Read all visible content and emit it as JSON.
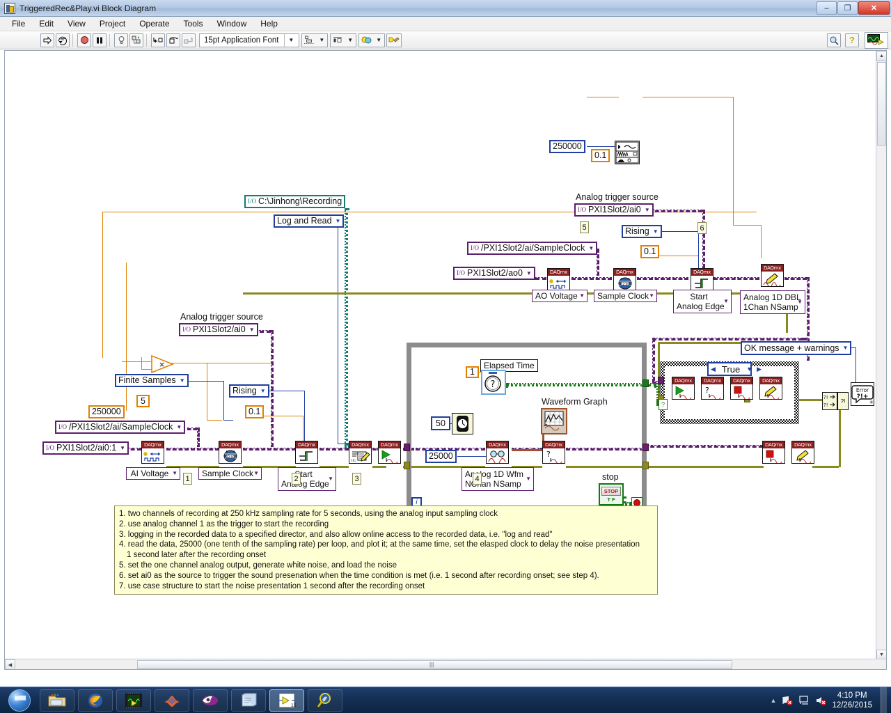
{
  "window": {
    "title": "TriggeredRec&Play.vi Block Diagram",
    "minimize": "–",
    "maximize": "❐",
    "close": "✕"
  },
  "menu": [
    "File",
    "Edit",
    "View",
    "Project",
    "Operate",
    "Tools",
    "Window",
    "Help"
  ],
  "toolbar": {
    "run_label": "run-arrow",
    "run_continuous_label": "run-continuously",
    "abort_label": "abort-execution",
    "pause_label": "pause",
    "highlight_label": "highlight-execution",
    "step_into_label": "step-into",
    "step_over_label": "step-over",
    "step_out_label": "step-out",
    "font": "15pt Application Font",
    "align_label": "align-objects",
    "distribute_label": "distribute-objects",
    "reorder_label": "reorder",
    "cleanup_label": "clean-up-diagram",
    "search_label": "search",
    "help_label": "?"
  },
  "diagram": {
    "constants": {
      "rate_ao": "250000",
      "amp_ao": "0.1",
      "rate_ai": "250000",
      "seconds": "5",
      "trig_level_ai": "0.1",
      "trig_level_ao": "0.1",
      "elapsed_target": "1",
      "wait_ms": "50",
      "samples_per_read": "25000"
    },
    "controls": {
      "log_path": "C:\\Jinhong\\Recording",
      "logging_mode": "Log and Read",
      "sample_mode": "Finite Samples",
      "ai_trigger_slope": "Rising",
      "ao_trigger_slope": "Rising",
      "ai_sample_clock_src": "/PXI1Slot2/ai/SampleClock",
      "ao_sample_clock_src": "/PXI1Slot2/ai/SampleClock",
      "ai_physical_channel": "PXI1Slot2/ai0:1",
      "ao_physical_channel": "PXI1Slot2/ao0",
      "analog_trigger_source_ai": "PXI1Slot2/ai0",
      "analog_trigger_source_ao": "PXI1Slot2/ai0",
      "error_dialog_type": "OK message + warnings",
      "case_selector": "True"
    },
    "labels": {
      "analog_trigger_source_ai": "Analog trigger source",
      "analog_trigger_source_ao": "Analog trigger source",
      "elapsed_time": "Elapsed Time",
      "waveform_graph": "Waveform Graph",
      "stop": "stop",
      "loop_index": "i"
    },
    "vi_labels": {
      "ai_voltage": "AI Voltage",
      "ai_sample_clock": "Sample Clock",
      "ai_start_trigger": "Start\nAnalog Edge",
      "ao_voltage": "AO Voltage",
      "ao_sample_clock": "Sample Clock",
      "ao_start_trigger": "Start\nAnalog Edge",
      "ao_write_type": "Analog 1D DBL\n1Chan NSamp",
      "ai_read_type": "Analog 1D Wfm\nNChan NSamp"
    },
    "daq_header": "DAQmx",
    "step_markers": [
      "1",
      "2",
      "3",
      "4",
      "5",
      "6"
    ],
    "stop_button_text": "STOP",
    "stop_button_tf": "T F",
    "error_icon_text": "Error",
    "error_icon_sub": "?!+"
  },
  "comment": {
    "lines": [
      {
        "text": "1. two channels of recording at 250 kHz sampling rate for 5 seconds, using the analog input sampling clock",
        "indent": false
      },
      {
        "text": "2. use analog channel 1 as the trigger to start the recording",
        "indent": false
      },
      {
        "text": "3. logging in the recorded data to a specified director, and also allow online access to the recorded data, i.e. \"log and read\"",
        "indent": false
      },
      {
        "text": "4. read the data, 25000 (one tenth of the sampling rate) per loop, and plot it; at the same time, set the elasped clock to delay the noise presentation",
        "indent": false
      },
      {
        "text": "1 second later after the recording onset",
        "indent": true
      },
      {
        "text": "5. set the one channel analog output, generate white noise, and load the noise",
        "indent": false
      },
      {
        "text": "6. set ai0 as the source to trigger the sound presenation when the time condition is met (i.e. 1 second after recording onset; see step 4).",
        "indent": false
      },
      {
        "text": "7. use case structure to start the noise presentation 1 second after the recording onset",
        "indent": false
      }
    ]
  },
  "taskbar": {
    "start": "start-orb",
    "items": [
      {
        "name": "explorer",
        "active": false
      },
      {
        "name": "firefox",
        "active": false
      },
      {
        "name": "labview-project",
        "active": false
      },
      {
        "name": "matlab",
        "active": false
      },
      {
        "name": "media-player",
        "active": false
      },
      {
        "name": "notepad",
        "active": false
      },
      {
        "name": "labview-vi",
        "active": true
      },
      {
        "name": "search-tool",
        "active": false
      }
    ],
    "clock_time": "4:10 PM",
    "clock_date": "12/26/2015"
  }
}
